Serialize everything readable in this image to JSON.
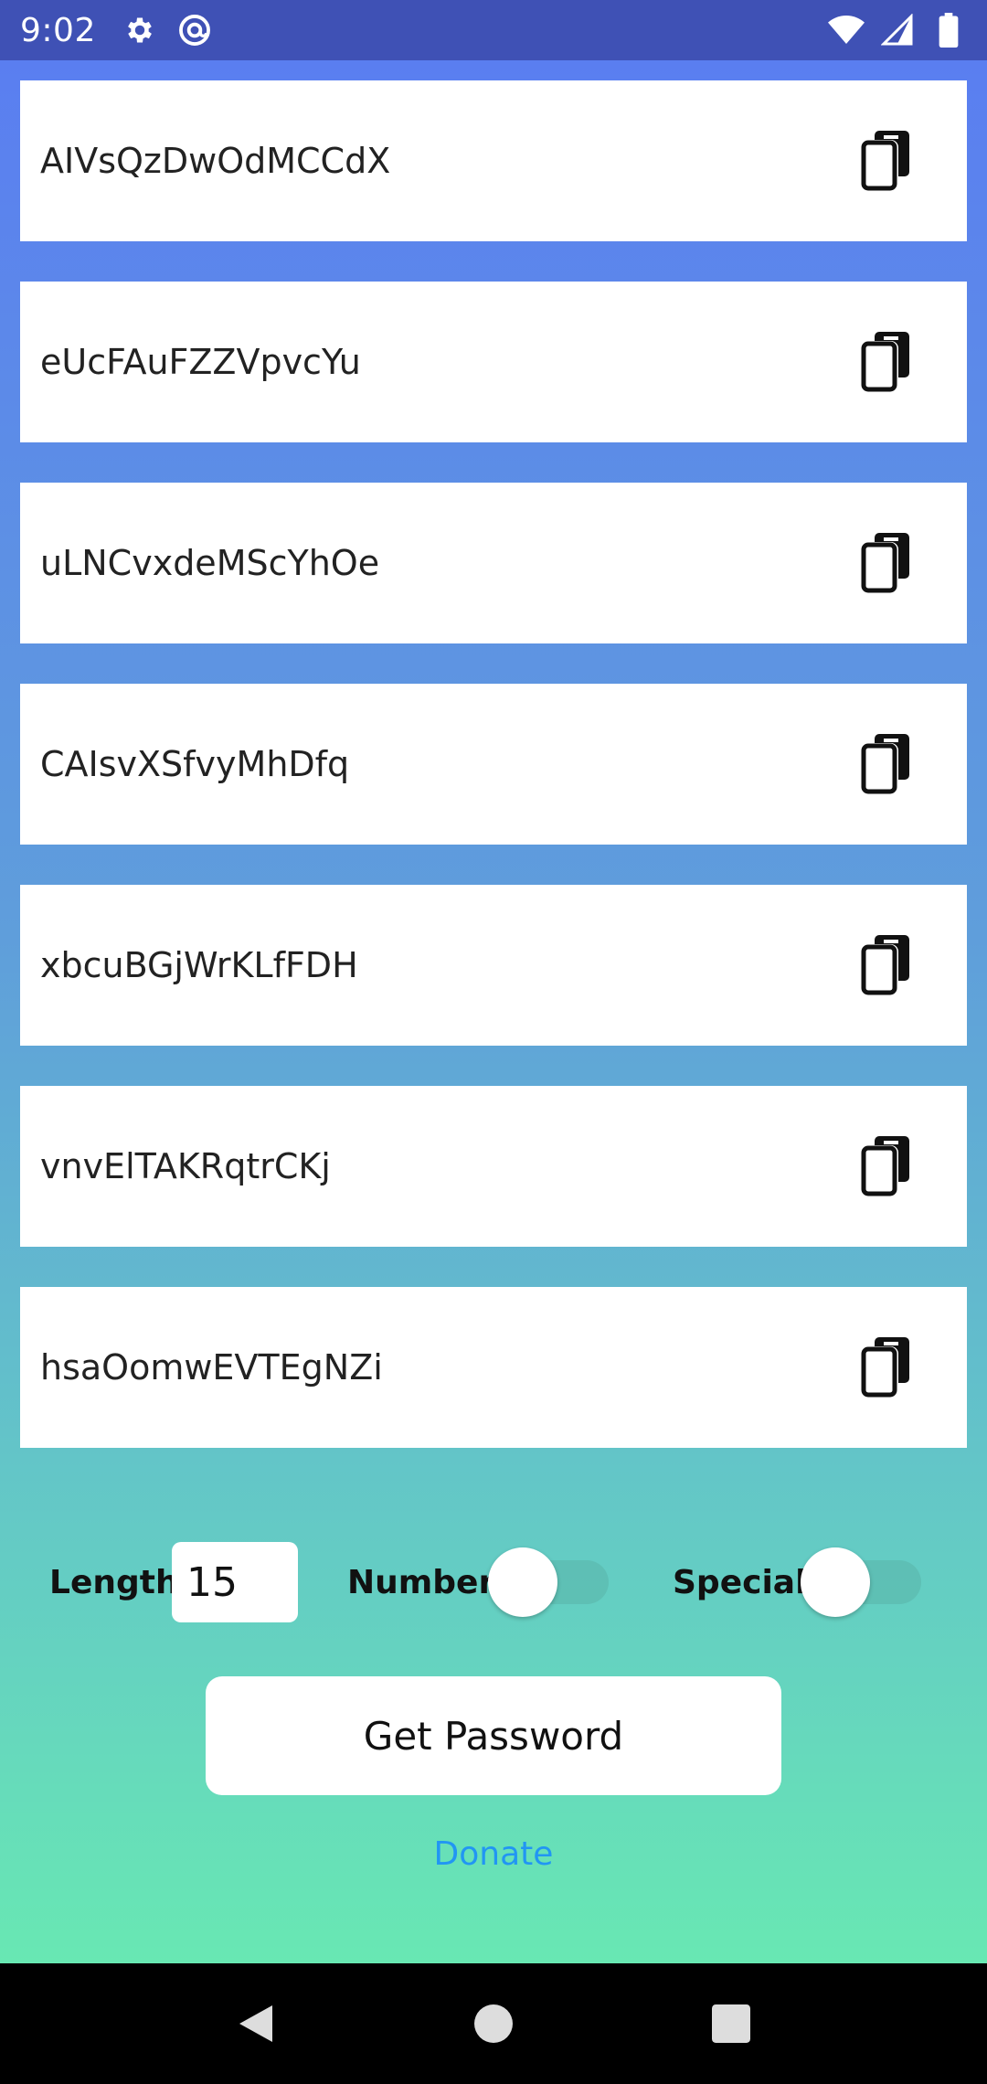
{
  "status_bar": {
    "time": "9:02",
    "icons": [
      "settings-icon",
      "at-sign-icon",
      "wifi-icon",
      "cellular-icon",
      "battery-icon"
    ]
  },
  "passwords": [
    "AIVsQzDwOdMCCdX",
    "eUcFAuFZZVpvcYu",
    "uLNCvxdeMScYhOe",
    "CAIsvXSfvyMhDfq",
    "xbcuBGjWrKLfFDH",
    "vnvElTAKRqtrCKj",
    "hsaOomwEVTEgNZi"
  ],
  "controls": {
    "length_label": "Length",
    "length_value": "15",
    "number_label": "Number",
    "number_enabled": false,
    "special_label": "Special",
    "special_enabled": false
  },
  "get_password_label": "Get Password",
  "donate_label": "Donate",
  "colors": {
    "status_bar": "#3f51b5",
    "gradient_top": "#5a7cf2",
    "gradient_bottom": "#69f0ae",
    "donate_link": "#2196f3"
  }
}
